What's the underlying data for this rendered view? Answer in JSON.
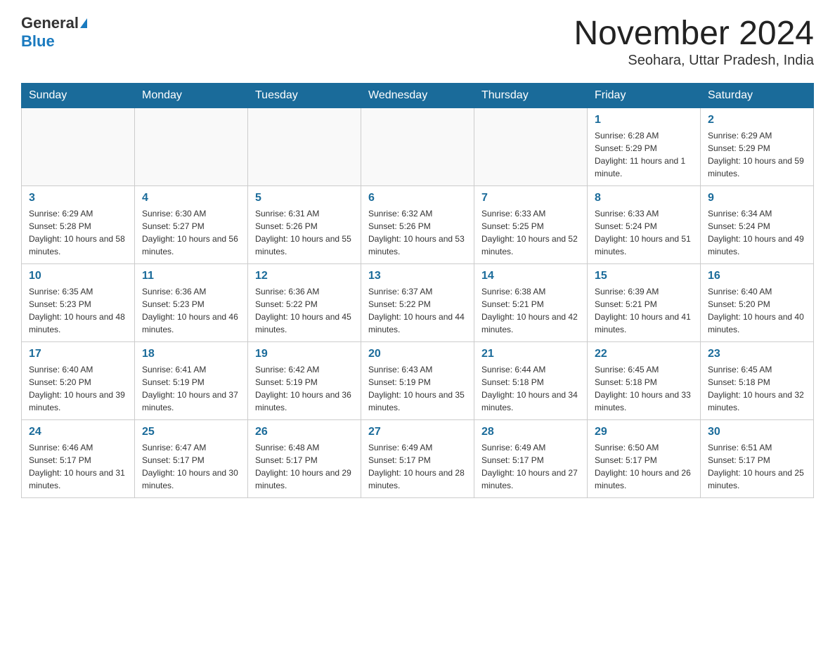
{
  "header": {
    "logo_general": "General",
    "logo_blue": "Blue",
    "month_title": "November 2024",
    "location": "Seohara, Uttar Pradesh, India"
  },
  "weekdays": [
    "Sunday",
    "Monday",
    "Tuesday",
    "Wednesday",
    "Thursday",
    "Friday",
    "Saturday"
  ],
  "weeks": [
    [
      {
        "day": "",
        "info": ""
      },
      {
        "day": "",
        "info": ""
      },
      {
        "day": "",
        "info": ""
      },
      {
        "day": "",
        "info": ""
      },
      {
        "day": "",
        "info": ""
      },
      {
        "day": "1",
        "info": "Sunrise: 6:28 AM\nSunset: 5:29 PM\nDaylight: 11 hours and 1 minute."
      },
      {
        "day": "2",
        "info": "Sunrise: 6:29 AM\nSunset: 5:29 PM\nDaylight: 10 hours and 59 minutes."
      }
    ],
    [
      {
        "day": "3",
        "info": "Sunrise: 6:29 AM\nSunset: 5:28 PM\nDaylight: 10 hours and 58 minutes."
      },
      {
        "day": "4",
        "info": "Sunrise: 6:30 AM\nSunset: 5:27 PM\nDaylight: 10 hours and 56 minutes."
      },
      {
        "day": "5",
        "info": "Sunrise: 6:31 AM\nSunset: 5:26 PM\nDaylight: 10 hours and 55 minutes."
      },
      {
        "day": "6",
        "info": "Sunrise: 6:32 AM\nSunset: 5:26 PM\nDaylight: 10 hours and 53 minutes."
      },
      {
        "day": "7",
        "info": "Sunrise: 6:33 AM\nSunset: 5:25 PM\nDaylight: 10 hours and 52 minutes."
      },
      {
        "day": "8",
        "info": "Sunrise: 6:33 AM\nSunset: 5:24 PM\nDaylight: 10 hours and 51 minutes."
      },
      {
        "day": "9",
        "info": "Sunrise: 6:34 AM\nSunset: 5:24 PM\nDaylight: 10 hours and 49 minutes."
      }
    ],
    [
      {
        "day": "10",
        "info": "Sunrise: 6:35 AM\nSunset: 5:23 PM\nDaylight: 10 hours and 48 minutes."
      },
      {
        "day": "11",
        "info": "Sunrise: 6:36 AM\nSunset: 5:23 PM\nDaylight: 10 hours and 46 minutes."
      },
      {
        "day": "12",
        "info": "Sunrise: 6:36 AM\nSunset: 5:22 PM\nDaylight: 10 hours and 45 minutes."
      },
      {
        "day": "13",
        "info": "Sunrise: 6:37 AM\nSunset: 5:22 PM\nDaylight: 10 hours and 44 minutes."
      },
      {
        "day": "14",
        "info": "Sunrise: 6:38 AM\nSunset: 5:21 PM\nDaylight: 10 hours and 42 minutes."
      },
      {
        "day": "15",
        "info": "Sunrise: 6:39 AM\nSunset: 5:21 PM\nDaylight: 10 hours and 41 minutes."
      },
      {
        "day": "16",
        "info": "Sunrise: 6:40 AM\nSunset: 5:20 PM\nDaylight: 10 hours and 40 minutes."
      }
    ],
    [
      {
        "day": "17",
        "info": "Sunrise: 6:40 AM\nSunset: 5:20 PM\nDaylight: 10 hours and 39 minutes."
      },
      {
        "day": "18",
        "info": "Sunrise: 6:41 AM\nSunset: 5:19 PM\nDaylight: 10 hours and 37 minutes."
      },
      {
        "day": "19",
        "info": "Sunrise: 6:42 AM\nSunset: 5:19 PM\nDaylight: 10 hours and 36 minutes."
      },
      {
        "day": "20",
        "info": "Sunrise: 6:43 AM\nSunset: 5:19 PM\nDaylight: 10 hours and 35 minutes."
      },
      {
        "day": "21",
        "info": "Sunrise: 6:44 AM\nSunset: 5:18 PM\nDaylight: 10 hours and 34 minutes."
      },
      {
        "day": "22",
        "info": "Sunrise: 6:45 AM\nSunset: 5:18 PM\nDaylight: 10 hours and 33 minutes."
      },
      {
        "day": "23",
        "info": "Sunrise: 6:45 AM\nSunset: 5:18 PM\nDaylight: 10 hours and 32 minutes."
      }
    ],
    [
      {
        "day": "24",
        "info": "Sunrise: 6:46 AM\nSunset: 5:17 PM\nDaylight: 10 hours and 31 minutes."
      },
      {
        "day": "25",
        "info": "Sunrise: 6:47 AM\nSunset: 5:17 PM\nDaylight: 10 hours and 30 minutes."
      },
      {
        "day": "26",
        "info": "Sunrise: 6:48 AM\nSunset: 5:17 PM\nDaylight: 10 hours and 29 minutes."
      },
      {
        "day": "27",
        "info": "Sunrise: 6:49 AM\nSunset: 5:17 PM\nDaylight: 10 hours and 28 minutes."
      },
      {
        "day": "28",
        "info": "Sunrise: 6:49 AM\nSunset: 5:17 PM\nDaylight: 10 hours and 27 minutes."
      },
      {
        "day": "29",
        "info": "Sunrise: 6:50 AM\nSunset: 5:17 PM\nDaylight: 10 hours and 26 minutes."
      },
      {
        "day": "30",
        "info": "Sunrise: 6:51 AM\nSunset: 5:17 PM\nDaylight: 10 hours and 25 minutes."
      }
    ]
  ]
}
